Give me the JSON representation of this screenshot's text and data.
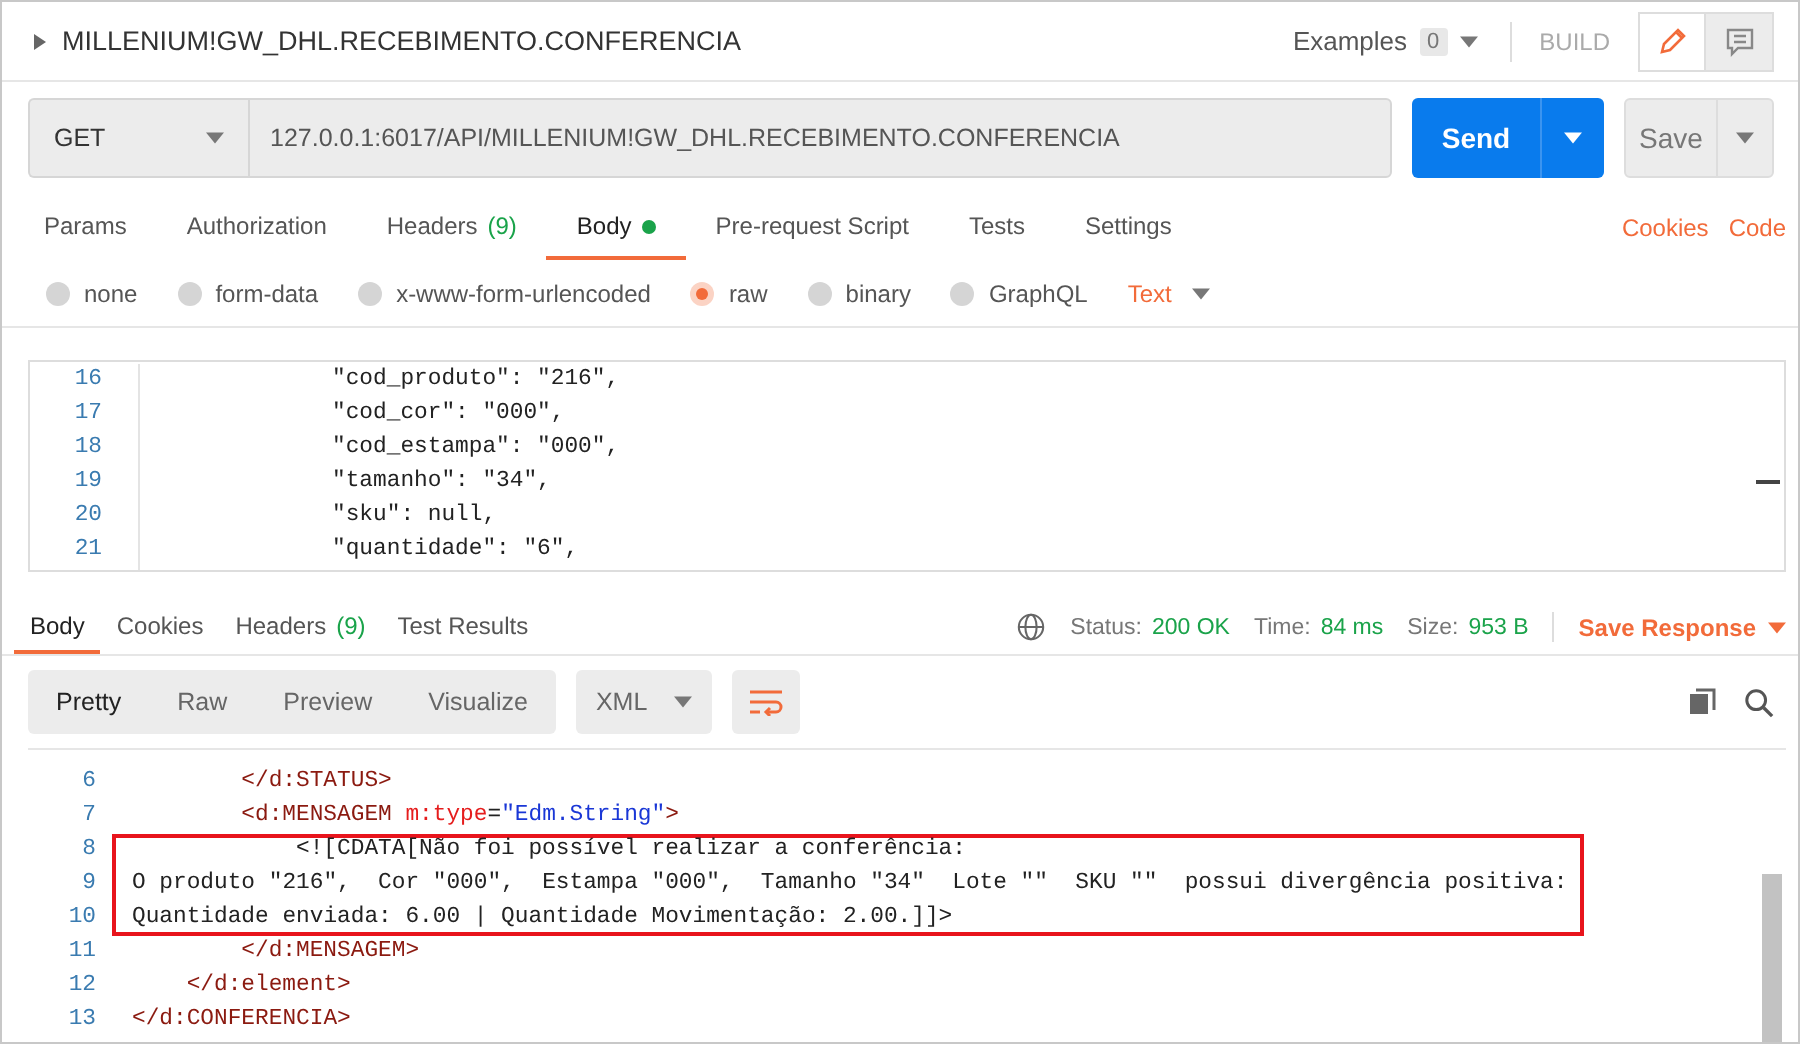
{
  "request": {
    "title": "MILLENIUM!GW_DHL.RECEBIMENTO.CONFERENCIA",
    "examples_label": "Examples",
    "examples_count": "0",
    "build_label": "BUILD",
    "method": "GET",
    "url": "127.0.0.1:6017/API/MILLENIUM!GW_DHL.RECEBIMENTO.CONFERENCIA",
    "send_label": "Send",
    "save_label": "Save"
  },
  "request_tabs": [
    {
      "label": "Params",
      "selected": false
    },
    {
      "label": "Authorization",
      "selected": false
    },
    {
      "label": "Headers",
      "count": "(9)",
      "selected": false
    },
    {
      "label": "Body",
      "selected": true,
      "has_content": true
    },
    {
      "label": "Pre-request Script",
      "selected": false
    },
    {
      "label": "Tests",
      "selected": false
    },
    {
      "label": "Settings",
      "selected": false
    }
  ],
  "request_links": [
    "Cookies",
    "Code"
  ],
  "body_types": [
    {
      "label": "none",
      "selected": false
    },
    {
      "label": "form-data",
      "selected": false
    },
    {
      "label": "x-www-form-urlencoded",
      "selected": false
    },
    {
      "label": "raw",
      "selected": true
    },
    {
      "label": "binary",
      "selected": false
    },
    {
      "label": "GraphQL",
      "selected": false
    }
  ],
  "body_format": "Text",
  "request_body": {
    "lines": [
      {
        "number": "16",
        "text": "            \"cod_produto\": \"216\","
      },
      {
        "number": "17",
        "text": "            \"cod_cor\": \"000\","
      },
      {
        "number": "18",
        "text": "            \"cod_estampa\": \"000\","
      },
      {
        "number": "19",
        "text": "            \"tamanho\": \"34\","
      },
      {
        "number": "20",
        "text": "            \"sku\": null,"
      },
      {
        "number": "21",
        "text": "            \"quantidade\": \"6\","
      }
    ]
  },
  "response_tabs": [
    {
      "label": "Body",
      "selected": true
    },
    {
      "label": "Cookies",
      "selected": false
    },
    {
      "label": "Headers",
      "count": "(9)",
      "selected": false
    },
    {
      "label": "Test Results",
      "selected": false
    }
  ],
  "response_status": [
    {
      "label": "Status:",
      "value": "200 OK"
    },
    {
      "label": "Time:",
      "value": "84 ms"
    },
    {
      "label": "Size:",
      "value": "953 B"
    }
  ],
  "save_response": "Save Response",
  "view_modes": [
    {
      "label": "Pretty",
      "selected": true
    },
    {
      "label": "Raw",
      "selected": false
    },
    {
      "label": "Preview",
      "selected": false
    },
    {
      "label": "Visualize",
      "selected": false
    }
  ],
  "response_format": "XML",
  "response_body": {
    "lines": [
      {
        "number": "6",
        "highlighted": false,
        "tokens": [
          {
            "kind": "tag",
            "text": "        </d:STATUS>"
          }
        ]
      },
      {
        "number": "7",
        "highlighted": false,
        "tokens": [
          {
            "kind": "tag",
            "text": "        <d:MENSAGEM"
          },
          {
            "kind": "attr",
            "text": " m:type"
          },
          {
            "kind": "plain",
            "text": "="
          },
          {
            "kind": "string",
            "text": "\"Edm.String\""
          },
          {
            "kind": "tag",
            "text": ">"
          }
        ]
      },
      {
        "number": "8",
        "highlighted": true,
        "tokens": [
          {
            "kind": "plain",
            "text": "            <![CDATA[Não foi possível realizar a conferência:"
          }
        ]
      },
      {
        "number": "9",
        "highlighted": true,
        "tokens": [
          {
            "kind": "plain",
            "text": "O produto \"216\",  Cor \"000\",  Estampa \"000\",  Tamanho \"34\"  Lote \"\"  SKU \"\"  possui divergência positiva:"
          }
        ]
      },
      {
        "number": "10",
        "highlighted": true,
        "tokens": [
          {
            "kind": "plain",
            "text": "Quantidade enviada: 6.00 | Quantidade Movimentação: 2.00.]]>"
          }
        ]
      },
      {
        "number": "11",
        "highlighted": false,
        "tokens": [
          {
            "kind": "tag",
            "text": "        </d:MENSAGEM>"
          }
        ]
      },
      {
        "number": "12",
        "highlighted": false,
        "tokens": [
          {
            "kind": "tag",
            "text": "    </d:element>"
          }
        ]
      },
      {
        "number": "13",
        "highlighted": false,
        "tokens": [
          {
            "kind": "tag",
            "text": "</d:CONFERENCIA>"
          }
        ]
      }
    ]
  }
}
